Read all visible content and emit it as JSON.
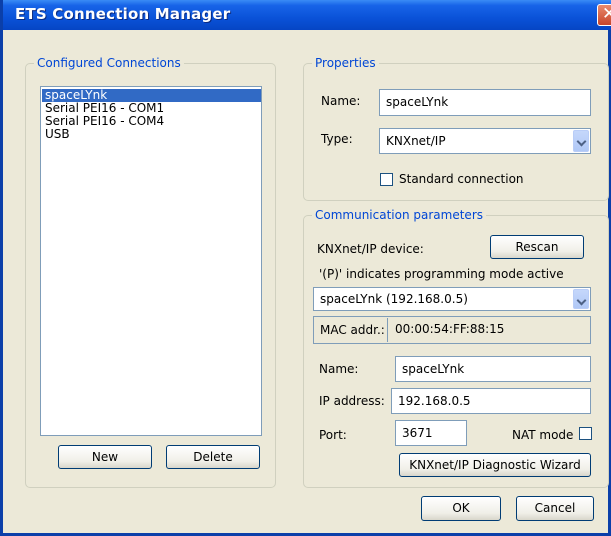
{
  "window": {
    "title": "ETS Connection Manager",
    "close_label": "✕"
  },
  "connections": {
    "legend": "Configured Connections",
    "items": [
      "spaceLYnk",
      "Serial PEI16 - COM1",
      "Serial PEI16 - COM4",
      "USB"
    ],
    "selected_index": 0,
    "new_label": "New",
    "delete_label": "Delete"
  },
  "properties": {
    "legend": "Properties",
    "name_label": "Name:",
    "name_value": "spaceLYnk",
    "type_label": "Type:",
    "type_value": "KNXnet/IP",
    "standard_label": "Standard connection",
    "standard_checked": false
  },
  "comm": {
    "legend": "Communication parameters",
    "device_label": "KNXnet/IP device:",
    "rescan_label": "Rescan",
    "prog_note": "'(P)' indicates programming mode active",
    "device_value": "spaceLYnk  (192.168.0.5)",
    "mac_label": "MAC addr.:",
    "mac_value": "00:00:54:FF:88:15",
    "name_label": "Name:",
    "name_value": "spaceLYnk",
    "ip_label": "IP address:",
    "ip_value": "192.168.0.5",
    "port_label": "Port:",
    "port_value": "3671",
    "nat_label": "NAT mode",
    "nat_checked": false,
    "wizard_label": "KNXnet/IP Diagnostic Wizard"
  },
  "footer": {
    "ok_label": "OK",
    "cancel_label": "Cancel"
  },
  "colors": {
    "accent": "#0046d5",
    "titlebar": "#0a52d8",
    "selection": "#316ac5",
    "dialog_bg": "#ece9d8"
  },
  "icons": {
    "close": "close-icon",
    "dropdown": "chevron-down-icon"
  }
}
